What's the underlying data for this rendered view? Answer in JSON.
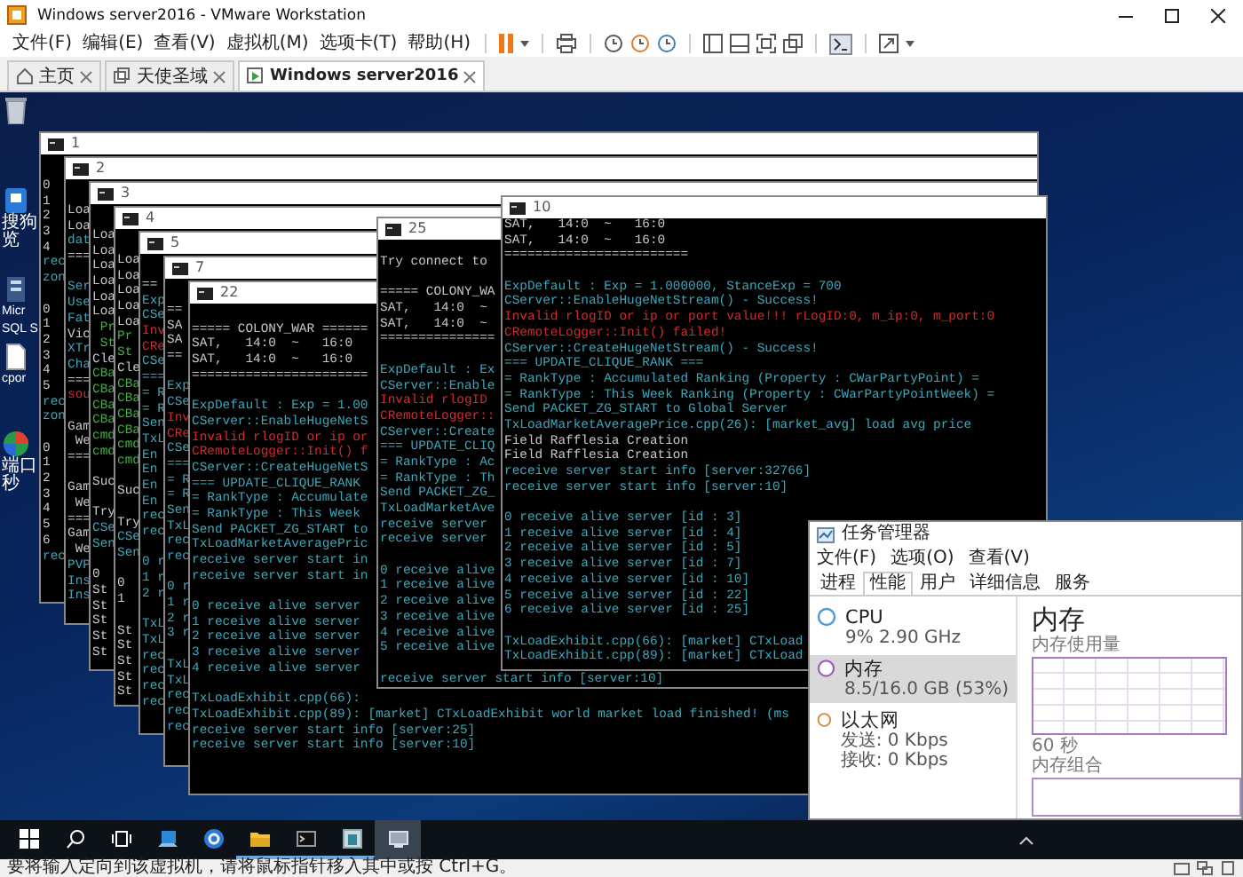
{
  "window": {
    "title": "Windows server2016 - VMware Workstation"
  },
  "menu": [
    "文件(F)",
    "编辑(E)",
    "查看(V)",
    "虚拟机(M)",
    "选项卡(T)",
    "帮助(H)"
  ],
  "tabs": [
    {
      "label": "主页",
      "kind": "home",
      "selected": false
    },
    {
      "label": "天使圣域",
      "kind": "library",
      "selected": false
    },
    {
      "label": "Windows server2016",
      "kind": "vm",
      "selected": true
    }
  ],
  "desktop_icons": [
    {
      "kind": "recycle"
    },
    {
      "kind": "sogou",
      "lines": [
        "搜狗",
        "览"
      ]
    },
    {
      "kind": "server",
      "lines": [
        "Micr",
        "SQL S"
      ]
    },
    {
      "kind": "document",
      "lines": [
        "cpor"
      ]
    },
    {
      "kind": "globe",
      "lines": [
        "端口",
        "秒"
      ]
    }
  ],
  "consoles": [
    {
      "title": "1",
      "lines": [
        {
          "text": "0"
        },
        {
          "text": "1"
        },
        {
          "text": "2"
        },
        {
          "text": "3"
        },
        {
          "text": "4"
        },
        {
          "text": "rec",
          "kind": "info"
        },
        {
          "text": "zon",
          "kind": "info"
        },
        {
          "text": "0",
          "gap": true
        },
        {
          "text": "1"
        },
        {
          "text": "2"
        },
        {
          "text": "3"
        },
        {
          "text": "4"
        },
        {
          "text": "5"
        },
        {
          "text": "rec",
          "kind": "info"
        },
        {
          "text": "zon",
          "kind": "info"
        },
        {
          "text": "0",
          "gap": true
        },
        {
          "text": "1"
        },
        {
          "text": "2"
        },
        {
          "text": "3"
        },
        {
          "text": "4"
        },
        {
          "text": "5"
        },
        {
          "text": "6"
        },
        {
          "text": "rec",
          "kind": "info"
        }
      ]
    },
    {
      "title": "2",
      "lines": [
        {
          "text": "Loa"
        },
        {
          "text": "Loa"
        },
        {
          "text": "dat",
          "kind": "info"
        },
        {
          "text": "==="
        },
        {
          "text": "Ser",
          "kind": "info",
          "gap": true
        },
        {
          "text": "Use",
          "kind": "info"
        },
        {
          "text": "Fat",
          "kind": "info"
        },
        {
          "text": "Vic"
        },
        {
          "text": "XTr",
          "kind": "info"
        },
        {
          "text": "Cha",
          "kind": "info"
        },
        {
          "text": "==="
        },
        {
          "text": "sou",
          "kind": "error"
        },
        {
          "text": "Gam",
          "gap": true
        },
        {
          "text": " We"
        },
        {
          "text": "==="
        },
        {
          "text": "Gam",
          "gap": true
        },
        {
          "text": " We"
        },
        {
          "text": "==="
        },
        {
          "text": "Gam"
        },
        {
          "text": " We"
        },
        {
          "text": "PVP",
          "kind": "info"
        },
        {
          "text": "Ins",
          "kind": "info"
        },
        {
          "text": "Ins",
          "kind": "info"
        }
      ]
    },
    {
      "title": "3",
      "lines": [
        {
          "text": "Loa"
        },
        {
          "text": "Loa"
        },
        {
          "text": "Loa"
        },
        {
          "text": "Loa"
        },
        {
          "text": "Loa"
        },
        {
          "text": "Loa"
        },
        {
          "text": " Pr",
          "kind": "ok"
        },
        {
          "text": " St",
          "kind": "ok"
        },
        {
          "text": "Cle"
        },
        {
          "text": "CBa",
          "kind": "ok"
        },
        {
          "text": "CBa",
          "kind": "ok"
        },
        {
          "text": "CBa",
          "kind": "ok"
        },
        {
          "text": "CBa",
          "kind": "ok"
        },
        {
          "text": "cmd",
          "kind": "ok"
        },
        {
          "text": "cmd",
          "kind": "ok"
        },
        {
          "text": "Suc",
          "gap": true
        },
        {
          "text": "Try",
          "gap": true
        },
        {
          "text": "CSe",
          "kind": "info"
        },
        {
          "text": "Sen",
          "kind": "info"
        },
        {
          "text": "0",
          "gap": true
        },
        {
          "text": "St"
        },
        {
          "text": "St"
        },
        {
          "text": "St"
        },
        {
          "text": "St"
        },
        {
          "text": "St"
        }
      ]
    },
    {
      "title": "4",
      "lines": [
        {
          "text": "Loa"
        },
        {
          "text": "Loa"
        },
        {
          "text": "Loa"
        },
        {
          "text": "Loa"
        },
        {
          "text": "Loa"
        },
        {
          "text": "Pr",
          "kind": "ok"
        },
        {
          "text": "St",
          "kind": "ok"
        },
        {
          "text": "Cle"
        },
        {
          "text": "CBa",
          "kind": "ok"
        },
        {
          "text": "CBa",
          "kind": "ok"
        },
        {
          "text": "CBa",
          "kind": "ok"
        },
        {
          "text": "CBa",
          "kind": "ok"
        },
        {
          "text": "cmd",
          "kind": "ok"
        },
        {
          "text": "cmd",
          "kind": "ok"
        },
        {
          "text": "Suc",
          "gap": true
        },
        {
          "text": "Try",
          "gap": true
        },
        {
          "text": "CSe",
          "kind": "info"
        },
        {
          "text": "Sen",
          "kind": "info"
        },
        {
          "text": "0",
          "gap": true
        },
        {
          "text": "1"
        },
        {
          "text": "St",
          "gap": true
        },
        {
          "text": "St"
        },
        {
          "text": "St"
        },
        {
          "text": "St"
        },
        {
          "text": "St"
        }
      ]
    },
    {
      "title": "5",
      "lines": [
        {
          "text": "=="
        },
        {
          "text": "Exp",
          "kind": "info"
        },
        {
          "text": "CSe",
          "kind": "info"
        },
        {
          "text": "Inv",
          "kind": "error"
        },
        {
          "text": "CRe",
          "kind": "error"
        },
        {
          "text": "CSe",
          "kind": "info"
        },
        {
          "text": "===",
          "kind": "info"
        },
        {
          "text": "= R",
          "kind": "info"
        },
        {
          "text": "= R",
          "kind": "info"
        },
        {
          "text": "Sen",
          "kind": "info"
        },
        {
          "text": "TxL",
          "kind": "info"
        },
        {
          "text": "En",
          "kind": "info"
        },
        {
          "text": "En",
          "kind": "info"
        },
        {
          "text": "En",
          "kind": "info"
        },
        {
          "text": "En",
          "kind": "info"
        },
        {
          "text": "rec",
          "kind": "info"
        },
        {
          "text": "rec",
          "kind": "info"
        },
        {
          "text": "0 r",
          "kind": "info",
          "gap": true
        },
        {
          "text": "1 r",
          "kind": "info"
        },
        {
          "text": "2 r",
          "kind": "info"
        },
        {
          "text": "TxL",
          "kind": "info",
          "gap": true
        },
        {
          "text": "TxL",
          "kind": "info"
        },
        {
          "text": "rec",
          "kind": "info"
        },
        {
          "text": "rec",
          "kind": "info"
        },
        {
          "text": "rec",
          "kind": "info"
        },
        {
          "text": "rec",
          "kind": "info"
        }
      ]
    },
    {
      "title": "7",
      "lines": [
        {
          "text": "=="
        },
        {
          "text": "SA"
        },
        {
          "text": "SA"
        },
        {
          "text": "=="
        },
        {
          "text": "Exp",
          "kind": "info",
          "gap": true
        },
        {
          "text": "CSe",
          "kind": "info"
        },
        {
          "text": "Inv",
          "kind": "error"
        },
        {
          "text": "CRe",
          "kind": "error"
        },
        {
          "text": "CSe",
          "kind": "info"
        },
        {
          "text": "===",
          "kind": "info"
        },
        {
          "text": "= R",
          "kind": "info"
        },
        {
          "text": "= R",
          "kind": "info"
        },
        {
          "text": "Sen",
          "kind": "info"
        },
        {
          "text": "TxL",
          "kind": "info"
        },
        {
          "text": "rec",
          "kind": "info"
        },
        {
          "text": "rec",
          "kind": "info"
        },
        {
          "text": "0 r",
          "kind": "info",
          "gap": true
        },
        {
          "text": "1 r",
          "kind": "info"
        },
        {
          "text": "2 r",
          "kind": "info"
        },
        {
          "text": "3 r",
          "kind": "info"
        },
        {
          "text": "TxL",
          "kind": "info",
          "gap": true
        },
        {
          "text": "TxL",
          "kind": "info"
        },
        {
          "text": "rec",
          "kind": "info"
        },
        {
          "text": "rec",
          "kind": "info"
        },
        {
          "text": "rec",
          "kind": "info"
        }
      ]
    },
    {
      "title": "22",
      "lines": [
        {
          "text": "===== COLONY_WAR ======",
          "gap": true
        },
        {
          "text": "SAT,   14:0  ~   16:0"
        },
        {
          "text": "SAT,   14:0  ~   16:0"
        },
        {
          "text": "======================="
        },
        {
          "text": "ExpDefault : Exp = 1.00",
          "kind": "info",
          "gap": true
        },
        {
          "text": "CServer::EnableHugeNetS",
          "kind": "info"
        },
        {
          "text": "Invalid rlogID or ip or",
          "kind": "error"
        },
        {
          "text": "CRemoteLogger::Init() f",
          "kind": "error"
        },
        {
          "text": "CServer::CreateHugeNetS",
          "kind": "info"
        },
        {
          "text": "=== UPDATE_CLIQUE_RANK",
          "kind": "info"
        },
        {
          "text": "= RankType : Accumulate",
          "kind": "info"
        },
        {
          "text": "= RankType : This Week",
          "kind": "info"
        },
        {
          "text": "Send PACKET_ZG_START to",
          "kind": "info"
        },
        {
          "text": "TxLoadMarketAveragePric",
          "kind": "info"
        },
        {
          "text": "receive server start in",
          "kind": "info"
        },
        {
          "text": "receive server start in",
          "kind": "info"
        },
        {
          "text": "0 receive alive server",
          "kind": "info",
          "gap": true
        },
        {
          "text": "1 receive alive server",
          "kind": "info"
        },
        {
          "text": "2 receive alive server",
          "kind": "info"
        },
        {
          "text": "3 receive alive server",
          "kind": "info"
        },
        {
          "text": "4 receive alive server",
          "kind": "info"
        },
        {
          "text": "TxLoadExhibit.cpp(66):",
          "kind": "info",
          "gap": true
        },
        {
          "text": "TxLoadExhibit.cpp(89): [market] CTxLoadExhibit world market load finished! (ms",
          "kind": "info"
        },
        {
          "text": "receive server start info [server:25]",
          "kind": "info"
        },
        {
          "text": "receive server start info [server:10]",
          "kind": "info"
        }
      ]
    },
    {
      "title": "25",
      "lines": [
        {
          "text": "Try connect to"
        },
        {
          "text": "===== COLONY_WA",
          "gap": true
        },
        {
          "text": "SAT,   14:0  ~"
        },
        {
          "text": "SAT,   14:0  ~"
        },
        {
          "text": "==============="
        },
        {
          "text": "ExpDefault : Ex",
          "kind": "info",
          "gap": true
        },
        {
          "text": "CServer::Enable",
          "kind": "info"
        },
        {
          "text": "Invalid rlogID",
          "kind": "error"
        },
        {
          "text": "CRemoteLogger::",
          "kind": "error"
        },
        {
          "text": "CServer::Create",
          "kind": "info"
        },
        {
          "text": "=== UPDATE_CLIQ",
          "kind": "info"
        },
        {
          "text": "= RankType : Ac",
          "kind": "info"
        },
        {
          "text": "= RankType : Th",
          "kind": "info"
        },
        {
          "text": "Send PACKET_ZG_",
          "kind": "info"
        },
        {
          "text": "TxLoadMarketAve",
          "kind": "info"
        },
        {
          "text": "receive server",
          "kind": "info"
        },
        {
          "text": "receive server",
          "kind": "info"
        },
        {
          "text": "0 receive alive",
          "kind": "info",
          "gap": true
        },
        {
          "text": "1 receive alive",
          "kind": "info"
        },
        {
          "text": "2 receive alive",
          "kind": "info"
        },
        {
          "text": "3 receive alive",
          "kind": "info"
        },
        {
          "text": "4 receive alive",
          "kind": "info"
        },
        {
          "text": "5 receive alive",
          "kind": "info"
        },
        {
          "text": "receive server start info [server:10]",
          "kind": "info",
          "gap": true
        }
      ]
    },
    {
      "title": "10",
      "lines": [
        {
          "text": "SAT,   14:0  ~   16:0"
        },
        {
          "text": "SAT,   14:0  ~   16:0"
        },
        {
          "text": "========================"
        },
        {
          "text": "ExpDefault : Exp = 1.000000, StanceExp = 700",
          "kind": "info",
          "gap": true
        },
        {
          "text": "CServer::EnableHugeNetStream() - Success!",
          "kind": "info"
        },
        {
          "text": "Invalid rlogID or ip or port value!!! rLogID:0, m_ip:0, m_port:0",
          "kind": "error"
        },
        {
          "text": "CRemoteLogger::Init() failed!",
          "kind": "error"
        },
        {
          "text": "CServer::CreateHugeNetStream() - Success!",
          "kind": "info"
        },
        {
          "text": "=== UPDATE_CLIQUE_RANK ===",
          "kind": "info"
        },
        {
          "text": "= RankType : Accumulated Ranking (Property : CWarPartyPoint) =",
          "kind": "info"
        },
        {
          "text": "= RankType : This Week Ranking (Property : CWarPartyPointWeek) =",
          "kind": "info"
        },
        {
          "text": "Send PACKET_ZG_START to Global Server",
          "kind": "info"
        },
        {
          "text": "TxLoadMarketAveragePrice.cpp(26): [market_avg] load avg price",
          "kind": "info"
        },
        {
          "text": "Field Rafflesia Creation"
        },
        {
          "text": "Field Rafflesia Creation"
        },
        {
          "text": "receive server start info [server:32766]",
          "kind": "info"
        },
        {
          "text": "receive server start info [server:10]",
          "kind": "info"
        },
        {
          "text": "0 receive alive server [id : 3]",
          "kind": "info",
          "gap": true
        },
        {
          "text": "1 receive alive server [id : 4]",
          "kind": "info"
        },
        {
          "text": "2 receive alive server [id : 5]",
          "kind": "info"
        },
        {
          "text": "3 receive alive server [id : 7]",
          "kind": "info"
        },
        {
          "text": "4 receive alive server [id : 10]",
          "kind": "info"
        },
        {
          "text": "5 receive alive server [id : 22]",
          "kind": "info"
        },
        {
          "text": "6 receive alive server [id : 25]",
          "kind": "info"
        },
        {
          "text": "TxLoadExhibit.cpp(66): [market] CTxLoad",
          "kind": "info",
          "gap": true
        },
        {
          "text": "TxLoadExhibit.cpp(89): [market] CTxLoad",
          "kind": "info"
        }
      ]
    }
  ],
  "task_manager": {
    "title": "任务管理器",
    "menu": [
      "文件(F)",
      "选项(O)",
      "查看(V)"
    ],
    "tabs": [
      {
        "label": "进程",
        "selected": false
      },
      {
        "label": "性能",
        "selected": true
      },
      {
        "label": "用户",
        "selected": false
      },
      {
        "label": "详细信息",
        "selected": false
      },
      {
        "label": "服务",
        "selected": false
      }
    ],
    "resources": [
      {
        "name": "CPU",
        "details": [
          "9% 2.90 GHz"
        ],
        "color": "#4a9bd8",
        "selected": false
      },
      {
        "name": "内存",
        "details": [
          "8.5/16.0 GB (53%)"
        ],
        "color": "#a05cc0",
        "selected": true
      },
      {
        "name": "以太网",
        "details": [
          "发送: 0 Kbps",
          "接收: 0 Kbps"
        ],
        "color": "#d08a3a",
        "selected": false
      }
    ],
    "heading": "内存",
    "usage_label": "内存使用量",
    "time_label": "60 秒",
    "composition_label": "内存组合"
  },
  "taskbar": [
    {
      "kind": "start",
      "running": false,
      "selected": false
    },
    {
      "kind": "search",
      "running": false,
      "selected": false
    },
    {
      "kind": "taskview",
      "running": false,
      "selected": false
    },
    {
      "kind": "screen",
      "running": false,
      "selected": false
    },
    {
      "kind": "app",
      "running": false,
      "selected": false
    },
    {
      "kind": "folder",
      "running": true,
      "selected": false
    },
    {
      "kind": "terminal",
      "running": true,
      "selected": false
    },
    {
      "kind": "window",
      "running": true,
      "selected": false
    },
    {
      "kind": "monitor",
      "running": false,
      "selected": true
    }
  ],
  "status_bar": {
    "text": "要将输入定向到该虚拟机，请将鼠标指针移入其中或按 Ctrl+G。"
  }
}
